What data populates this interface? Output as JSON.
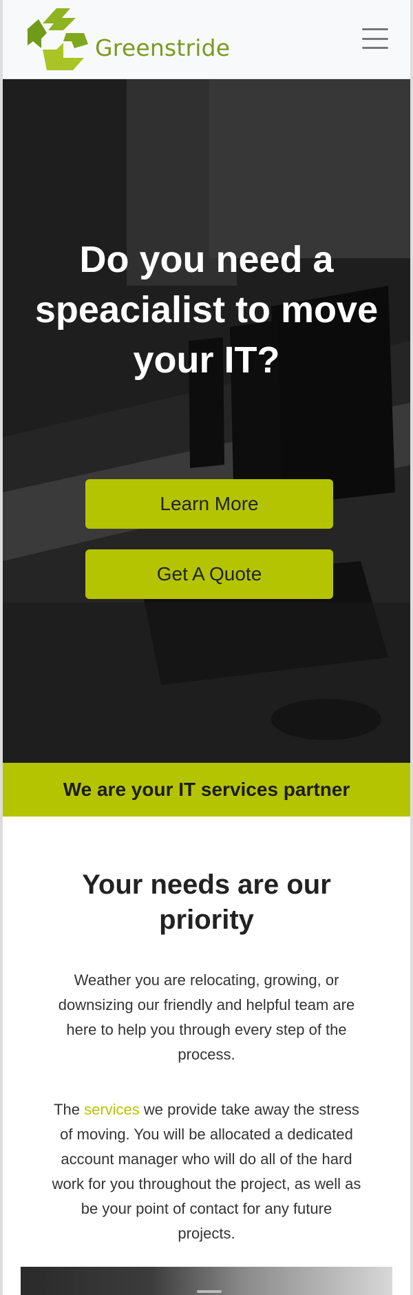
{
  "header": {
    "brand": "Greenstride",
    "logo_icon": "greenstride-arrows-logo",
    "menu_icon": "hamburger-menu-icon"
  },
  "hero": {
    "title": "Do you need a speacialist to move your IT?",
    "background": "office-computers-photo",
    "learn_more_label": "Learn More",
    "quote_label": "Get A Quote"
  },
  "banner": {
    "text": "We are your IT services partner"
  },
  "main": {
    "heading": "Your needs are our priority",
    "paragraph_1": "Weather you are relocating, growing, or downsizing our friendly and helpful team are here to help you through every step of the process.",
    "paragraph_2_prefix": "The ",
    "paragraph_2_link": "services",
    "paragraph_2_suffix": " we provide take away the stress of moving. You will be allocated a dedicated account manager who will do all of the hard work for you throughout the project, as well as be your point of contact for any future projects."
  },
  "colors": {
    "accent": "#b5c400",
    "brand_green": "#7a9a1e",
    "header_bg": "#f8f9fa",
    "hero_text": "#ffffff"
  }
}
